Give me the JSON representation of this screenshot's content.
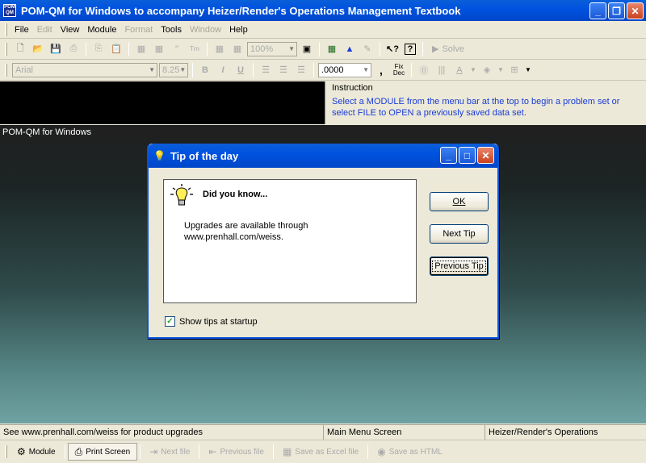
{
  "window": {
    "title": "POM-QM for Windows to accompany Heizer/Render's Operations Management Textbook",
    "icon_text": "POM QM",
    "minimize_icon": "minimize-icon",
    "restore_icon": "restore-icon",
    "close_icon": "close-icon"
  },
  "menu": {
    "items": [
      {
        "label": "File",
        "enabled": true
      },
      {
        "label": "Edit",
        "enabled": false
      },
      {
        "label": "View",
        "enabled": true
      },
      {
        "label": "Module",
        "enabled": true
      },
      {
        "label": "Format",
        "enabled": false
      },
      {
        "label": "Tools",
        "enabled": true
      },
      {
        "label": "Window",
        "enabled": false
      },
      {
        "label": "Help",
        "enabled": true
      }
    ]
  },
  "toolbar1": {
    "zoom_value": "100%",
    "solve_label": "Solve"
  },
  "toolbar2": {
    "font_name": "Arial",
    "font_size": "8.25",
    "bold": "B",
    "italic": "I",
    "underline": "U",
    "decimal_format": ".0000",
    "comma": ",",
    "fix_dec_top": "Fix",
    "fix_dec_bottom": "Dec"
  },
  "instruction": {
    "label": "Instruction",
    "text": "Select a MODULE from the menu bar at the top to begin a problem set or select FILE to OPEN a previously saved data set."
  },
  "workspace": {
    "label": "POM-QM for Windows"
  },
  "dialog": {
    "title": "Tip of the day",
    "heading": "Did you know...",
    "tip_text": "Upgrades are available through www.prenhall.com/weiss.",
    "ok_label": "OK",
    "next_tip_label": "Next Tip",
    "previous_tip_label": "Previous Tip",
    "show_tips_label": "Show tips at startup",
    "show_tips_checked": true
  },
  "statusbar": {
    "left": "See www.prenhall.com/weiss for product upgrades",
    "middle": "Main Menu Screen",
    "right": "Heizer/Render's Operations"
  },
  "bottombar": {
    "module_label": "Module",
    "print_screen_label": "Print Screen",
    "next_file_label": "Next file",
    "previous_file_label": "Previous file",
    "save_excel_label": "Save as Excel file",
    "save_html_label": "Save as HTML"
  },
  "colors": {
    "titlebar": "#0053e0",
    "instruction_text": "#1a3cd6",
    "chrome": "#ece9d8"
  }
}
